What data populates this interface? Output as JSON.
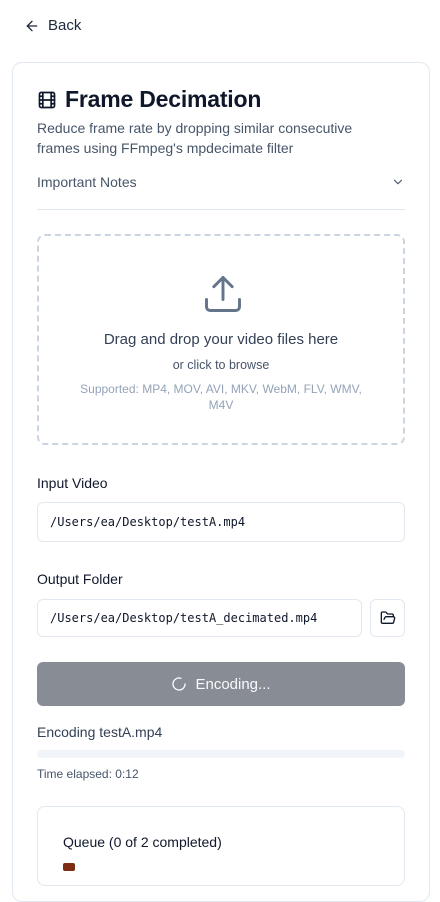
{
  "nav": {
    "back_label": "Back"
  },
  "header": {
    "title": "Frame Decimation",
    "subtitle": "Reduce frame rate by dropping similar consecutive frames using FFmpeg's mpdecimate filter"
  },
  "notes": {
    "label": "Important Notes"
  },
  "dropzone": {
    "title": "Drag and drop your video files here",
    "subtitle": "or click to browse",
    "formats": "Supported: MP4, MOV, AVI, MKV, WebM, FLV, WMV, M4V"
  },
  "input_video": {
    "label": "Input Video",
    "value": "/Users/ea/Desktop/testA.mp4"
  },
  "output_folder": {
    "label": "Output Folder",
    "value": "/Users/ea/Desktop/testA_decimated.mp4"
  },
  "encode_button": {
    "label": "Encoding..."
  },
  "progress": {
    "status": "Encoding testA.mp4",
    "percent": 0,
    "elapsed": "Time elapsed: 0:12"
  },
  "queue": {
    "title": "Queue (0 of 2 completed)"
  },
  "icons": {
    "back": "arrow-left-icon",
    "title": "film-icon",
    "notes": "chevron-down-icon",
    "upload": "upload-icon",
    "browse": "folder-open-icon",
    "spinner": "loader-icon"
  }
}
